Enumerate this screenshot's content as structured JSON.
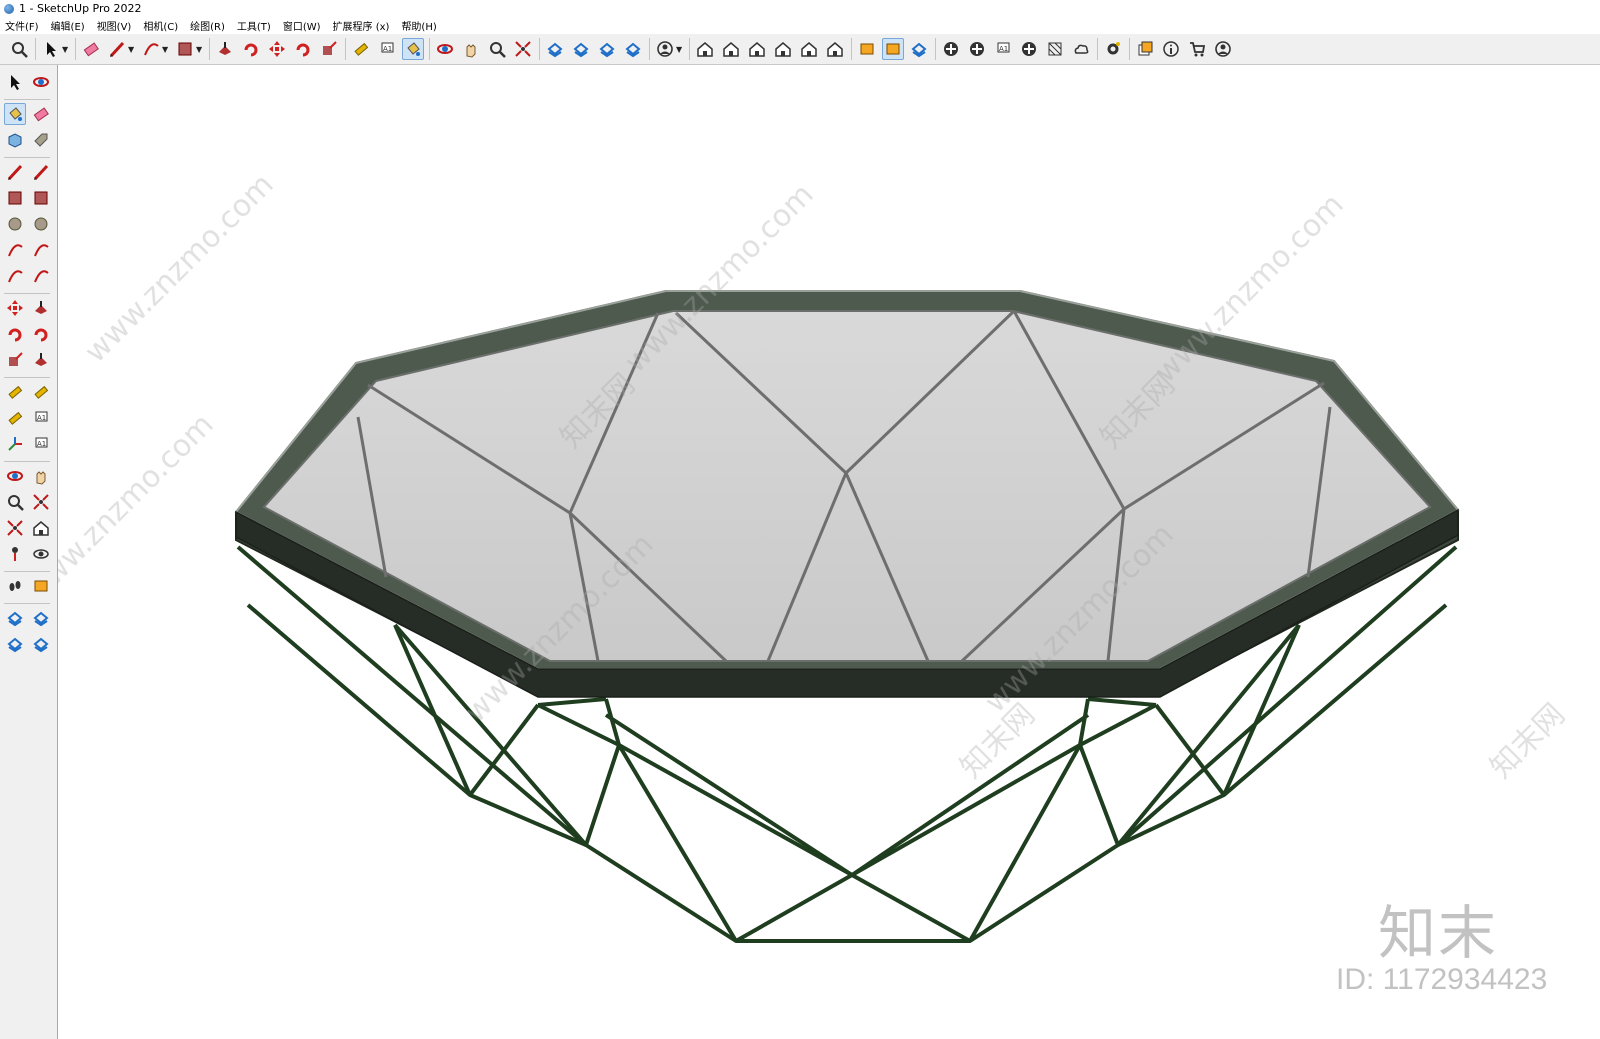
{
  "window": {
    "title": "1 - SketchUp Pro 2022"
  },
  "menu": [
    "文件(F)",
    "编辑(E)",
    "视图(V)",
    "相机(C)",
    "绘图(R)",
    "工具(T)",
    "窗口(W)",
    "扩展程序 (x)",
    "帮助(H)"
  ],
  "icons": {
    "top": [
      "search-icon",
      "select-icon",
      "eraser-icon",
      "pencil-icon",
      "arc-icon",
      "rectangle-icon",
      "push-pull-icon",
      "follow-me-icon",
      "move-icon",
      "rotate-icon",
      "scale-icon",
      "tape-measure-icon",
      "text-icon",
      "paint-bucket-icon",
      "orbit-icon",
      "pan-icon",
      "zoom-icon",
      "zoom-extents-icon",
      "3d-warehouse-icon",
      "extension-warehouse-icon",
      "layout-icon",
      "extension-manager-icon",
      "user-account-icon",
      "iso-view-icon",
      "top-view-icon",
      "front-view-icon",
      "right-view-icon",
      "back-view-icon",
      "left-view-icon",
      "section-plane-icon",
      "display-section-icon",
      "section-cuts-icon",
      "add-location-icon",
      "toggle-terrain-icon",
      "photo-texture-icon",
      "geo-location-icon",
      "match-photo-icon",
      "cloud-icon",
      "settings-icon",
      "outliner-icon",
      "entity-info-icon",
      "cart-icon",
      "profile-icon"
    ],
    "left": [
      "select-icon",
      "orbit-icon",
      "paint-bucket-icon",
      "eraser-icon",
      "component-icon",
      "tag-icon",
      "pencil-icon",
      "freehand-icon",
      "rectangle-icon",
      "rotated-rectangle-icon",
      "circle-icon",
      "polygon-icon",
      "arc-icon",
      "two-point-arc-icon",
      "three-point-arc-icon",
      "pie-icon",
      "move-icon",
      "push-pull-icon",
      "rotate-icon",
      "follow-me-icon",
      "scale-icon",
      "offset-icon",
      "tape-measure-icon",
      "dimension-icon",
      "protractor-icon",
      "text-icon",
      "axes-icon",
      "3d-text-icon",
      "orbit-icon",
      "pan-icon",
      "zoom-icon",
      "zoom-window-icon",
      "zoom-extents-icon",
      "previous-view-icon",
      "position-camera-icon",
      "look-around-icon",
      "walk-icon",
      "section-plane-icon",
      "3d-warehouse-icon",
      "extension-warehouse-icon",
      "layout-icon",
      "extension-manager-icon"
    ]
  },
  "watermark": {
    "text": "www.znzmo.com",
    "text2": "知末网"
  },
  "brand": {
    "logo": "知末",
    "id": "ID: 1172934423"
  },
  "colors": {
    "glass": "#d3d3d3",
    "frame": "#2c372c",
    "frame_edge": "#4f5a4f",
    "wire": "#1f3d1f"
  }
}
